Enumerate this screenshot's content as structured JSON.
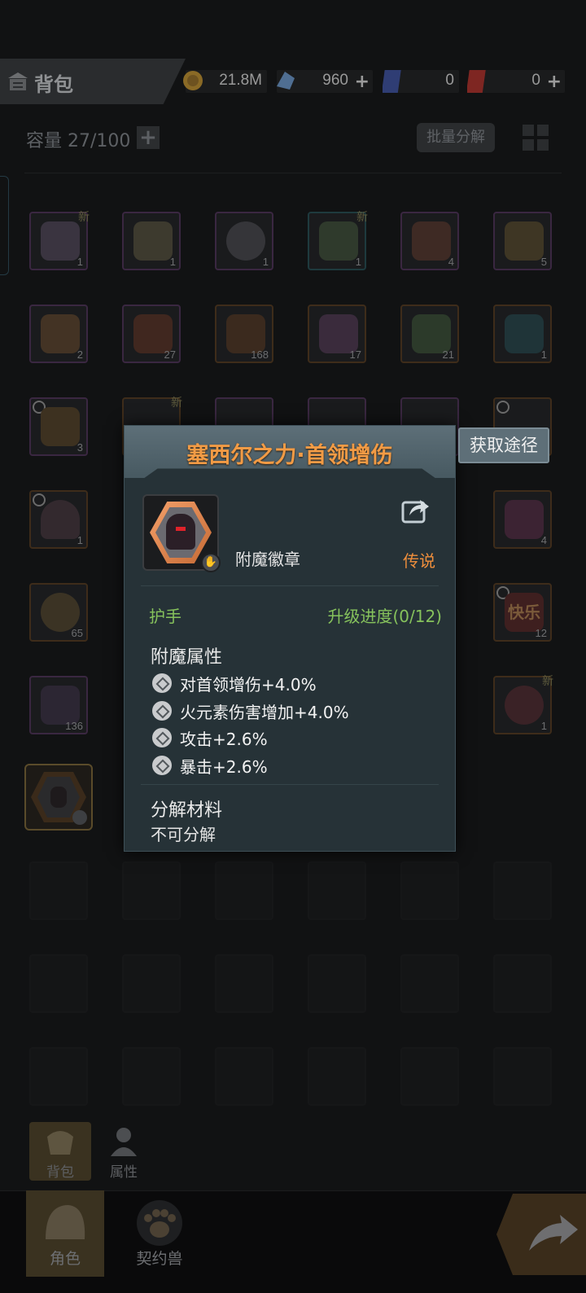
{
  "header": {
    "title": "背包",
    "resources": [
      {
        "name": "gold",
        "value": "21.8M",
        "color": "#b98a2a"
      },
      {
        "name": "crystal",
        "value": "960",
        "color": "#6e8fb5"
      },
      {
        "name": "blue-ticket",
        "value": "0",
        "color": "#3b4f9c"
      },
      {
        "name": "red-ticket",
        "value": "0",
        "color": "#b0302c"
      }
    ]
  },
  "toolbar": {
    "capacity": "容量 27/100",
    "batch_decompose": "批量分解"
  },
  "inventory": {
    "row1": [
      {
        "count": "1",
        "new": "新",
        "quality": "purple"
      },
      {
        "count": "1",
        "new": "",
        "quality": "purple"
      },
      {
        "count": "1",
        "new": "",
        "quality": "purple"
      },
      {
        "count": "1",
        "new": "新",
        "quality": "cyan"
      },
      {
        "count": "4",
        "new": "",
        "quality": "purple"
      },
      {
        "count": "5",
        "new": "",
        "quality": "purple"
      }
    ],
    "row2": [
      {
        "count": "2"
      },
      {
        "count": "27"
      },
      {
        "count": "168"
      },
      {
        "count": "17"
      },
      {
        "count": "21"
      },
      {
        "count": "1"
      }
    ],
    "row3": [
      {
        "count": "3"
      },
      {
        "count": "",
        "new": "新"
      }
    ],
    "row4": [
      {
        "count": "1"
      },
      {
        "count": "4"
      }
    ],
    "row5": [
      {
        "count": "65"
      },
      {
        "count": "12",
        "label": "快乐"
      }
    ],
    "row6": [
      {
        "count": "136"
      },
      {
        "count": "1",
        "new": "新"
      }
    ]
  },
  "popup": {
    "title": "塞西尔之力·首领增伤",
    "obtain_button": "获取途径",
    "item_type": "附魔徽章",
    "rarity": "传说",
    "slot": "护手",
    "upgrade_progress": "升级进度(0/12)",
    "enchant_section": "附魔属性",
    "attributes": [
      "对首领增伤+4.0%",
      "火元素伤害增加+4.0%",
      "攻击+2.6%",
      "暴击+2.6%"
    ],
    "decompose_section": "分解材料",
    "decompose_value": "不可分解"
  },
  "subtabs": {
    "bag": "背包",
    "attributes": "属性"
  },
  "nav": {
    "character": "角色",
    "pet": "契约兽"
  },
  "colors": {
    "title_orange": "#f29b45",
    "green": "#86c25c",
    "legend_orange": "#f08f3c"
  }
}
